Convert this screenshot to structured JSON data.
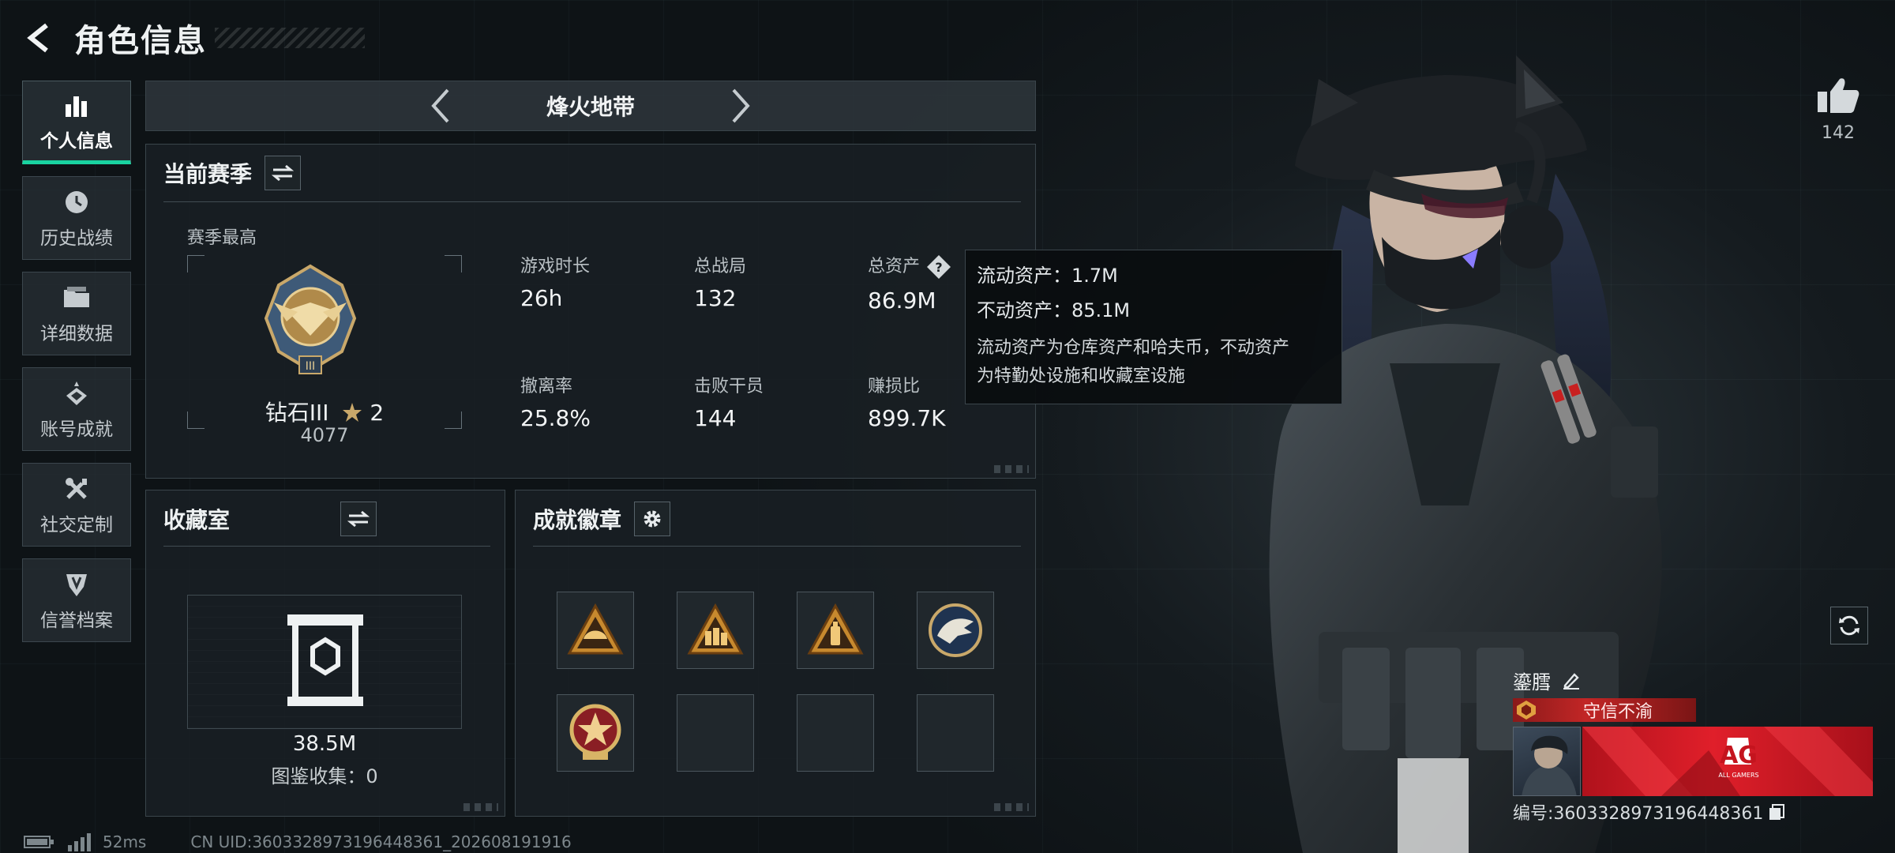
{
  "header": {
    "title": "角色信息"
  },
  "sidebar": {
    "items": [
      {
        "label": "个人信息",
        "icon": "bar-chart-icon",
        "active": true
      },
      {
        "label": "历史战绩",
        "icon": "clock-icon"
      },
      {
        "label": "详细数据",
        "icon": "folder-icon"
      },
      {
        "label": "账号成就",
        "icon": "achievement-icon"
      },
      {
        "label": "社交定制",
        "icon": "tools-icon"
      },
      {
        "label": "信誉档案",
        "icon": "shield-icon"
      }
    ]
  },
  "mode": {
    "name": "烽火地带"
  },
  "season": {
    "title": "当前赛季",
    "best_label": "赛季最高",
    "rank_name": "钻石III",
    "rank_stars": "2",
    "rank_score": "4077",
    "stats": [
      {
        "label": "游戏时长",
        "value": "26h"
      },
      {
        "label": "总战局",
        "value": "132"
      },
      {
        "label": "总资产",
        "value": "86.9M"
      },
      {
        "label": "撤离率",
        "value": "25.8%"
      },
      {
        "label": "击败干员",
        "value": "144"
      },
      {
        "label": "赚损比",
        "value": "899.7K"
      }
    ]
  },
  "tooltip": {
    "liquid": "流动资产：1.7M",
    "fixed": "不动资产：85.1M",
    "desc_line1": "流动资产为仓库资产和哈夫币，不动资产",
    "desc_line2": "为特勤处设施和收藏室设施"
  },
  "collection": {
    "title": "收藏室",
    "value": "38.5M",
    "count": "图鉴收集：0"
  },
  "badges": {
    "title": "成就徽章",
    "slots": [
      {
        "filled": true,
        "icon": "helmet-badge-icon"
      },
      {
        "filled": true,
        "icon": "soldiers-badge-icon"
      },
      {
        "filled": true,
        "icon": "bottle-badge-icon"
      },
      {
        "filled": true,
        "icon": "eagle-badge-icon"
      },
      {
        "filled": true,
        "icon": "star-medal-badge-icon"
      },
      {
        "filled": false
      },
      {
        "filled": false
      },
      {
        "filled": false
      }
    ]
  },
  "likes": {
    "count": "142"
  },
  "profile": {
    "name": "鎏膤",
    "reputation": "守信不渝",
    "uid": "编号:3603328973196448361",
    "banner_brand": "AG",
    "banner_sub": "ALL GAMERS"
  },
  "status": {
    "ping": "52ms",
    "uid": "CN UID:3603328973196448361_202608191916"
  },
  "colors": {
    "accent": "#19d3a0",
    "reputation": "#c22626",
    "banner": "#e01f2a"
  }
}
